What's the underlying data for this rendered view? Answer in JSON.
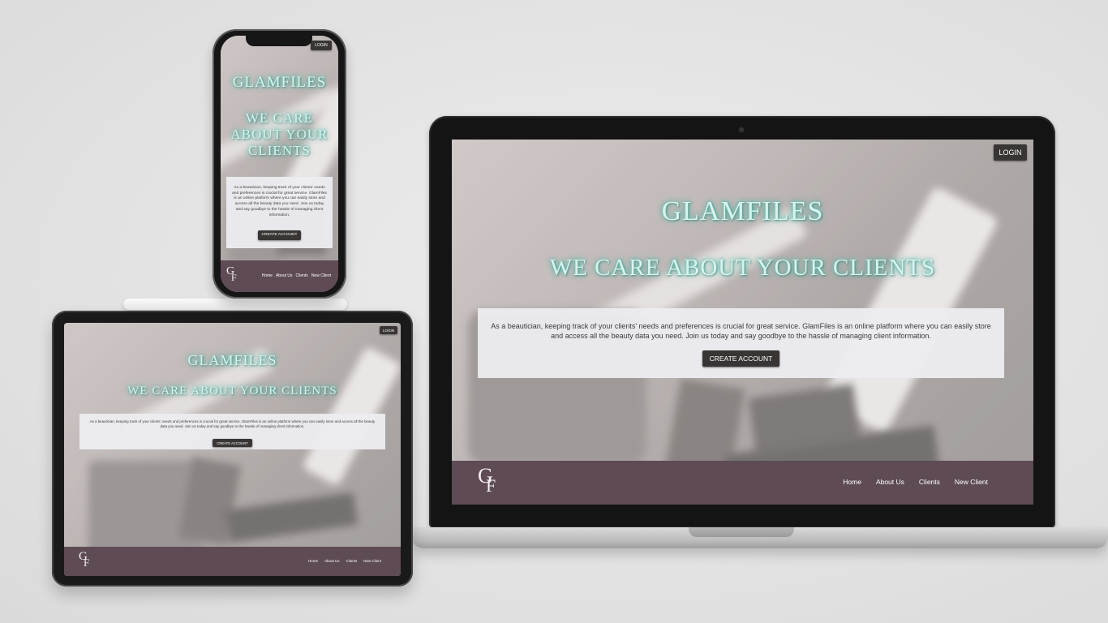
{
  "site": {
    "brand": "GLAMFILES",
    "tagline": "WE CARE ABOUT YOUR CLIENTS",
    "tagline_phone_lines": [
      "WE CARE",
      "ABOUT YOUR",
      "CLIENTS"
    ],
    "login_label": "LOGIN",
    "description": "As a beautician, keeping track of your clients' needs and preferences is crucial for great service. GlamFiles is an online platform where you can easily store and access all the beauty data you need. Join us today and say goodbye to the hassle of managing client information.",
    "cta_label": "CREATE ACCOUNT",
    "logo_letters": [
      "G",
      "F"
    ],
    "nav": [
      "Home",
      "About Us",
      "Clients",
      "New Client"
    ]
  },
  "colors": {
    "footer": "#5e4b55",
    "button": "#3a3535",
    "heading_glow": "#5ec9b8",
    "info_box": "#ececf0"
  },
  "icons": {
    "camera": "laptop-camera-icon"
  }
}
